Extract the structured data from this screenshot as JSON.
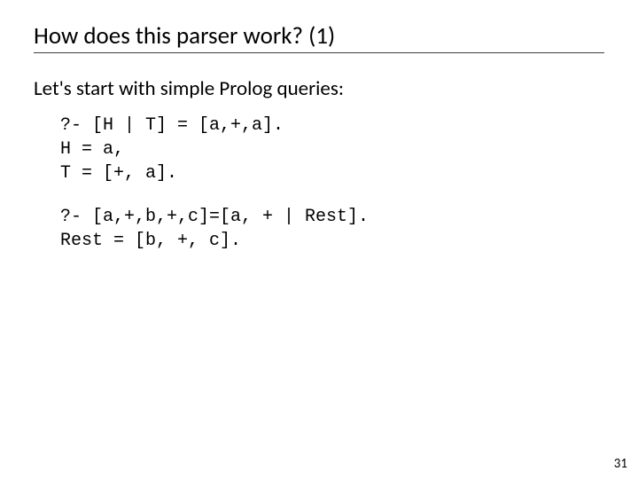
{
  "title": "How does this parser work? (1)",
  "subtitle": "Let's start with simple Prolog queries:",
  "code1_line1": "?- [H | T] = [a,+,a].",
  "code1_line2": "H = a,",
  "code1_line3": "T = [+, a].",
  "code2_line1": "?- [a,+,b,+,c]=[a, + | Rest].",
  "code2_line2": "Rest = [b, +, c].",
  "page_number": "31"
}
